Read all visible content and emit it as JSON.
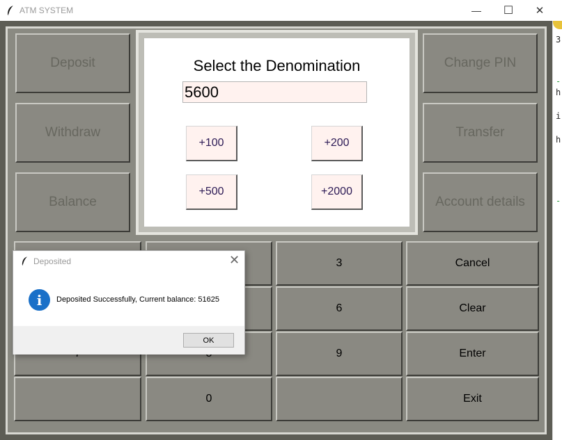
{
  "window": {
    "title": "ATM SYSTEM",
    "minimize": "—",
    "maximize": "☐",
    "close": "✕"
  },
  "left_buttons": [
    "Deposit",
    "Withdraw",
    "Balance"
  ],
  "right_buttons": [
    "Change PIN",
    "Transfer",
    "Account details"
  ],
  "screen": {
    "title": "Select the Denomination",
    "amount": "5600",
    "denominations": [
      "+100",
      "+200",
      "+500",
      "+2000"
    ]
  },
  "keypad": {
    "row1": [
      "",
      "",
      "3",
      "Cancel"
    ],
    "row2": [
      "",
      "",
      "6",
      "Clear"
    ],
    "row3": [
      "7",
      "8",
      "9",
      "Enter"
    ],
    "row4": [
      "",
      "0",
      "",
      "Exit"
    ]
  },
  "dialog": {
    "title": "Deposited",
    "message": "Deposited Successfully, Current balance: 51625",
    "ok": "OK",
    "close": "✕",
    "info_glyph": "i"
  },
  "background_editor": {
    "fragments": [
      "3",
      "h",
      "i",
      "h",
      "-",
      "-"
    ]
  },
  "colors": {
    "atm_frame": "#5d5d55",
    "button_face": "#8a8982",
    "screen_input": "#fff2ef",
    "info_blue": "#1a70c8"
  }
}
